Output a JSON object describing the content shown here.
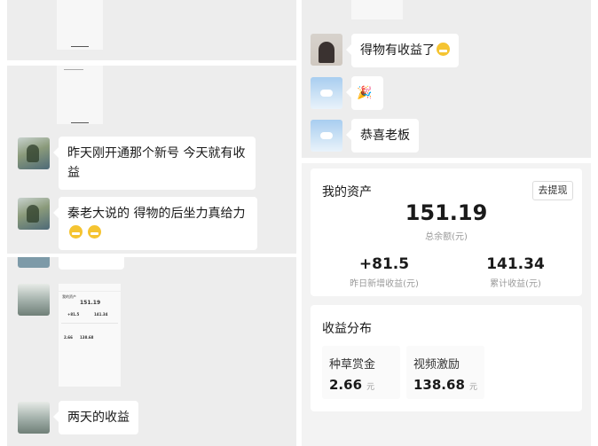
{
  "left_chat": {
    "msg1": "昨天刚开通那个新号 今天就有收益",
    "msg2": "秦老大说的 得物的后坐力真给力",
    "msg3": "两天的收益"
  },
  "mini_screenshot": {
    "title": "我的资产",
    "amount": "151.19",
    "left_value": "+81.5",
    "right_value": "141.34",
    "sub_left": "2.66",
    "sub_right": "138.68"
  },
  "right_chat": {
    "msg1": "得物有收益了",
    "msg2": "🎉",
    "msg3": "恭喜老板"
  },
  "assets": {
    "title": "我的资产",
    "withdraw_label": "去提现",
    "balance": "151.19",
    "balance_caption": "总余额(元)",
    "yesterday_value": "+81.5",
    "yesterday_label": "昨日新增收益(元)",
    "total_value": "141.34",
    "total_label": "累计收益(元)"
  },
  "distribution": {
    "title": "收益分布",
    "item1_label": "种草赏金",
    "item1_value": "2.66",
    "item2_label": "视频激励",
    "item2_value": "138.68",
    "unit": "元"
  },
  "colors": {
    "panel_bg": "#ededed",
    "bubble_bg": "#ffffff",
    "text": "#191919",
    "muted": "#9a9a9a"
  }
}
